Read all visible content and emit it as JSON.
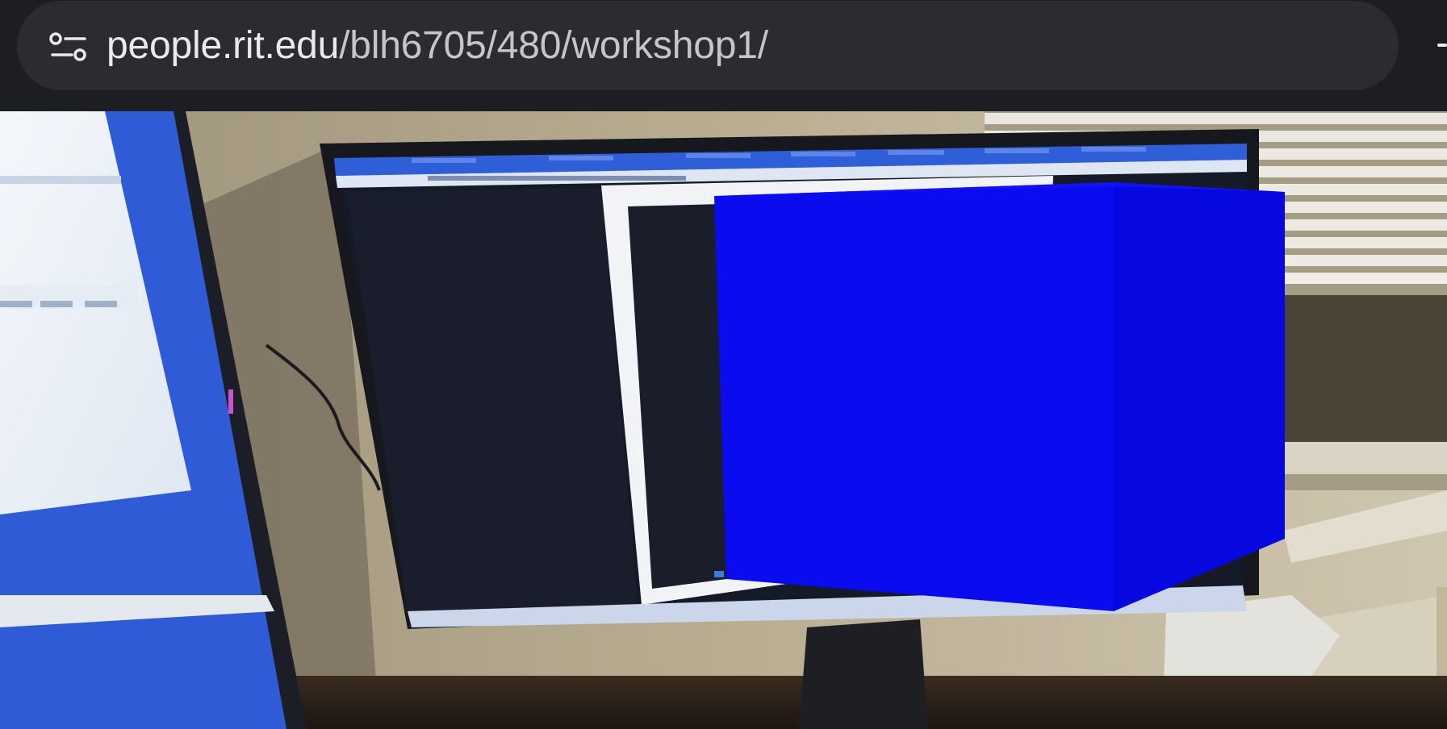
{
  "address_bar": {
    "url_host": "people.rit.edu",
    "url_path": "/blh6705/480/workshop1/",
    "site_info_icon": "tune-icon"
  },
  "ar_scene": {
    "cube_color_front": "#0b0bf0",
    "cube_color_side": "#0707e0",
    "cube_color_top": "#1212f5"
  },
  "colors": {
    "toolbar_bg": "#1d1e21",
    "omnibox_bg": "#2a2c31",
    "url_text": "#e8eaed",
    "url_path_text": "#c4c7c5"
  }
}
